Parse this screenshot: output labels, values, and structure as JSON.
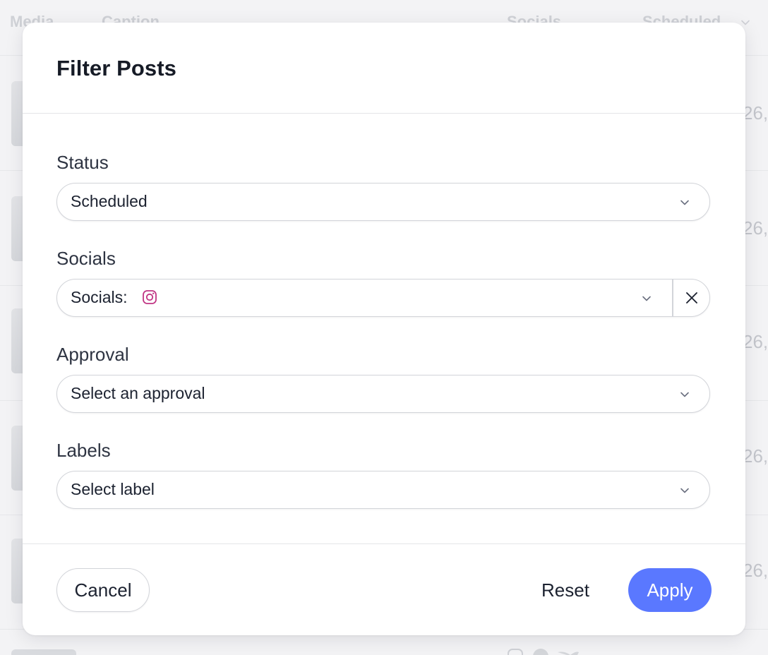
{
  "background": {
    "columns": {
      "media": "Media",
      "caption": "Caption",
      "socials": "Socials",
      "scheduled": "Scheduled"
    },
    "row_date_fragments": [
      "26,",
      "26,",
      "26,",
      "26,",
      "26,"
    ]
  },
  "modal": {
    "title": "Filter Posts",
    "fields": {
      "status": {
        "label": "Status",
        "value": "Scheduled"
      },
      "socials": {
        "label": "Socials",
        "value_prefix": "Socials:",
        "selected_icon": "instagram-icon"
      },
      "approval": {
        "label": "Approval",
        "placeholder": "Select an approval"
      },
      "labels": {
        "label": "Labels",
        "placeholder": "Select label"
      }
    },
    "footer": {
      "cancel_label": "Cancel",
      "reset_label": "Reset",
      "apply_label": "Apply"
    }
  },
  "colors": {
    "accent": "#5a78ff",
    "instagram": "#c13584",
    "title_text": "#161b26",
    "body_text": "#1c2230",
    "border": "#d2d4d9"
  }
}
